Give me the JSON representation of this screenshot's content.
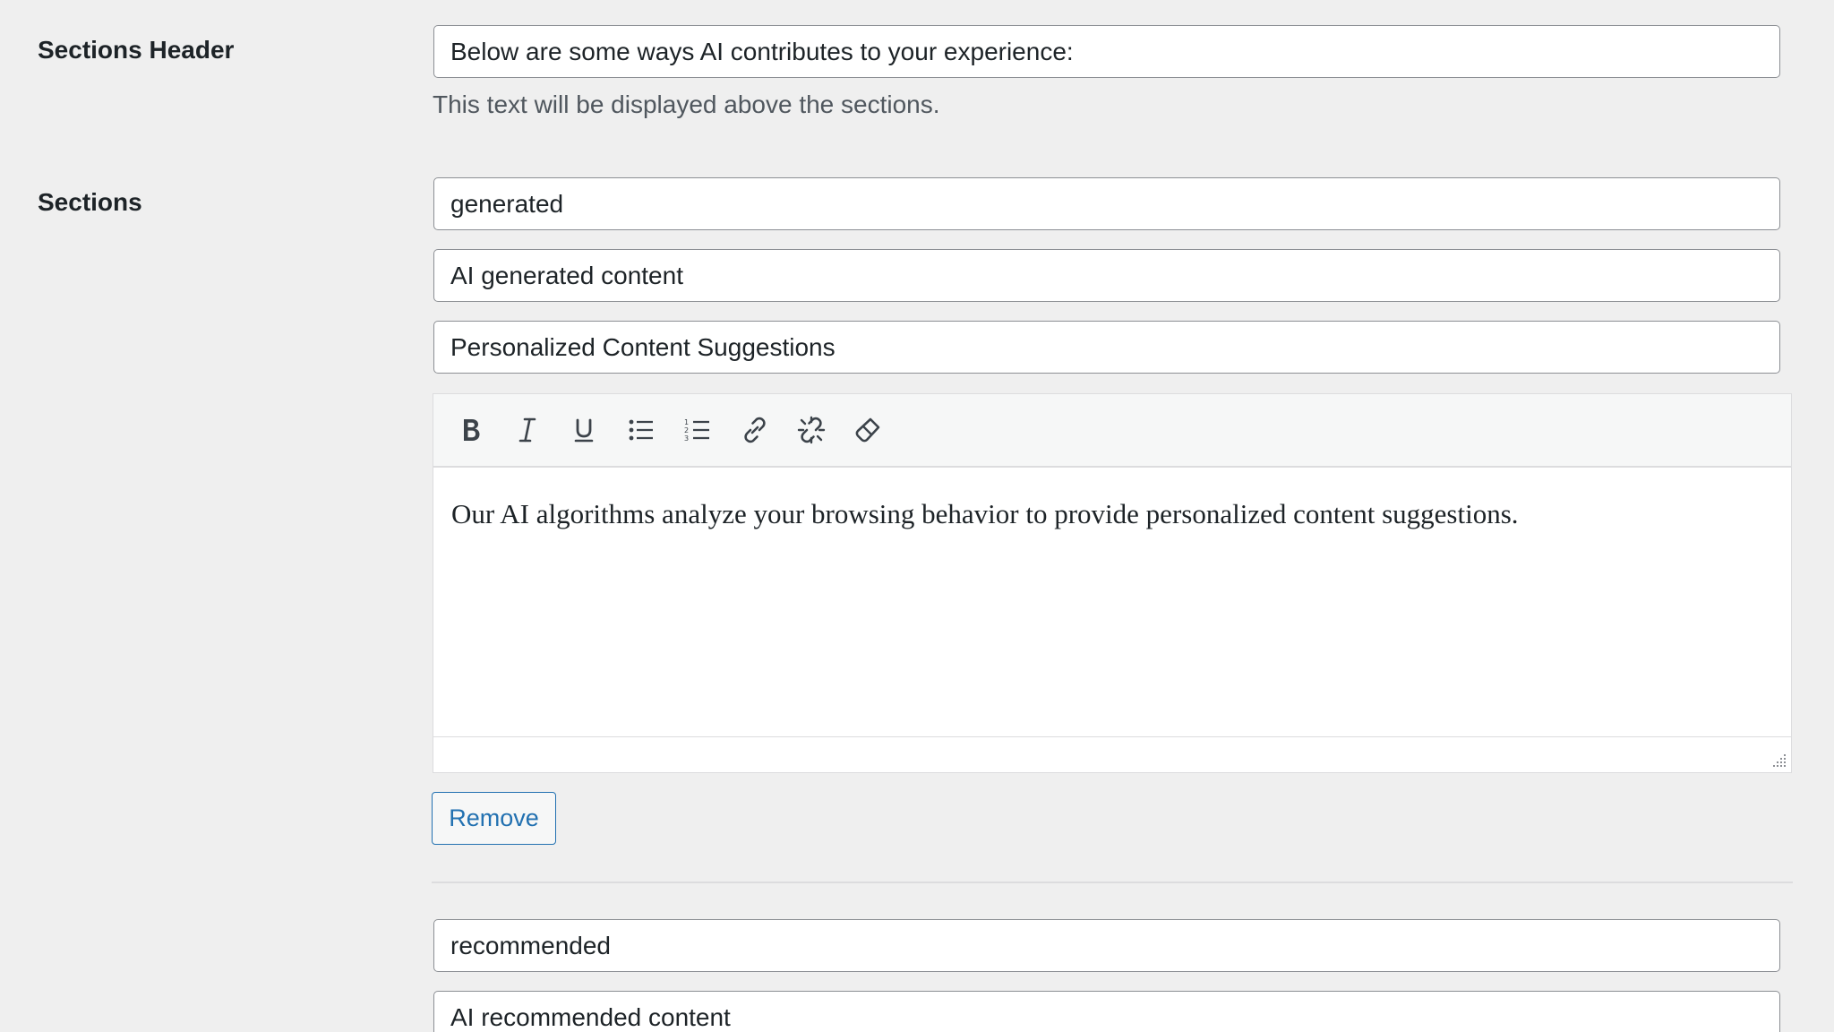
{
  "sections_header": {
    "label": "Sections Header",
    "value": "Below are some ways AI contributes to your experience:",
    "description": "This text will be displayed above the sections."
  },
  "sections": {
    "label": "Sections",
    "items": [
      {
        "key": "generated",
        "title": "AI generated content",
        "heading": "Personalized Content Suggestions",
        "body": "Our AI algorithms analyze your browsing behavior to provide personalized content suggestions."
      },
      {
        "key": "recommended",
        "title": "AI recommended content"
      }
    ],
    "remove_label": "Remove"
  },
  "editor": {
    "toolbar_icons": [
      "bold-icon",
      "italic-icon",
      "underline-icon",
      "bullet-list-icon",
      "numbered-list-icon",
      "link-icon",
      "unlink-icon",
      "clear-formatting-icon"
    ]
  },
  "colors": {
    "background": "#efefef",
    "accent": "#2271b1",
    "text": "#1d2327",
    "muted": "#50575e",
    "border": "#8c8f94"
  }
}
